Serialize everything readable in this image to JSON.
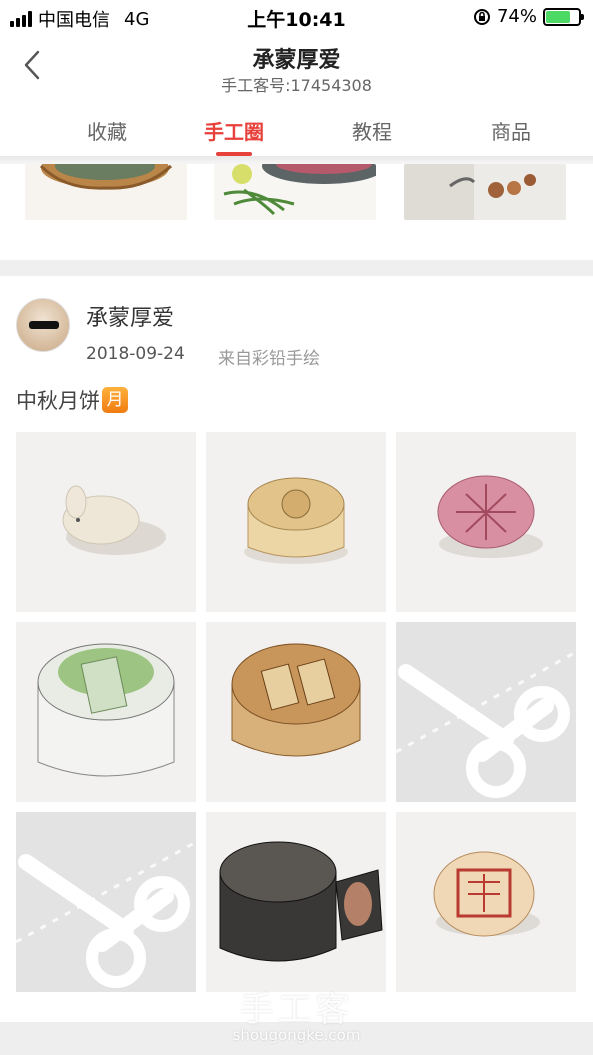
{
  "status_bar": {
    "carrier": "中国电信",
    "network": "4G",
    "time": "上午10:41",
    "battery": "74%",
    "battery_level": 0.74
  },
  "header": {
    "title": "承蒙厚爱",
    "subtitle": "手工客号:17454308"
  },
  "tabs": [
    {
      "label": "收藏",
      "active": false
    },
    {
      "label": "手工圈",
      "active": true
    },
    {
      "label": "教程",
      "active": false
    },
    {
      "label": "商品",
      "active": false
    }
  ],
  "post": {
    "author": "承蒙厚爱",
    "date": "2018-09-24",
    "source": "来自彩铅手绘",
    "text": "中秋月饼",
    "emoji_text": "月"
  },
  "watermark": {
    "brand": "手工客",
    "url": "shougongke.com"
  },
  "colors": {
    "accent": "#e8403a",
    "battery": "#4cd964"
  }
}
